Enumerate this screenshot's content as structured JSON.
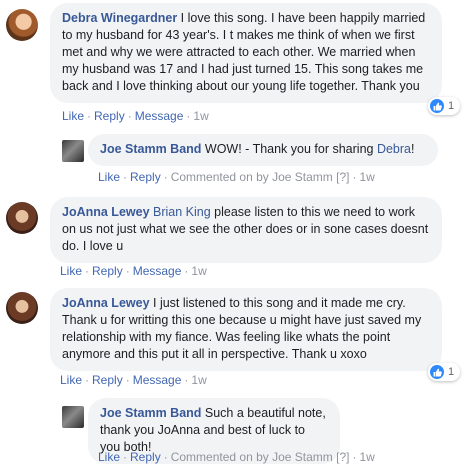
{
  "comments": [
    {
      "author": "Debra Winegardner",
      "text": " I love this song. I have been happily married to my husband for 43 year's. I t makes me think of when we first met and why we were attracted to each other. We married when my husband was 17 and I had just turned 15. This song takes me back and I love thinking about our young life together. Thank you",
      "actions": {
        "like": "Like",
        "reply": "Reply",
        "message": "Message",
        "time": "1w"
      },
      "reaction_count": "1",
      "reply": {
        "author": "Joe Stamm Band",
        "text_before": " WOW! - Thank you for sharing ",
        "tag": "Debra",
        "text_after": "!",
        "actions": {
          "like": "Like",
          "reply": "Reply",
          "commented": "Commented on by Joe Stamm",
          "help": "[?]",
          "time": "1w"
        }
      }
    },
    {
      "author": "JoAnna Lewey",
      "tag": "Brian King",
      "text": " please listen to this we need to work on us not just what we see the other does or in sone cases doesnt do. I love u",
      "actions": {
        "like": "Like",
        "reply": "Reply",
        "message": "Message",
        "time": "1w"
      }
    },
    {
      "author": "JoAnna Lewey",
      "text": " I just listened to this song and it made me cry. Thank u for writting this one because u might have just saved my relationship with my fiance. Was feeling like whats the point anymore and this put it all in perspective. Thank u xoxo",
      "actions": {
        "like": "Like",
        "reply": "Reply",
        "message": "Message",
        "time": "1w"
      },
      "reaction_count": "1",
      "reply": {
        "author": "Joe Stamm Band",
        "text": " Such a beautiful note, thank you JoAnna and best of luck to you both!",
        "actions": {
          "like": "Like",
          "reply": "Reply",
          "commented": "Commented on by Joe Stamm",
          "help": "[?]",
          "time": "1w"
        }
      }
    }
  ],
  "colors": {
    "link": "#385898",
    "action": "#4267b2",
    "bubble": "#f2f3f5",
    "like": "#2e89ff"
  },
  "icons": {
    "reaction": "like-thumb-icon"
  }
}
